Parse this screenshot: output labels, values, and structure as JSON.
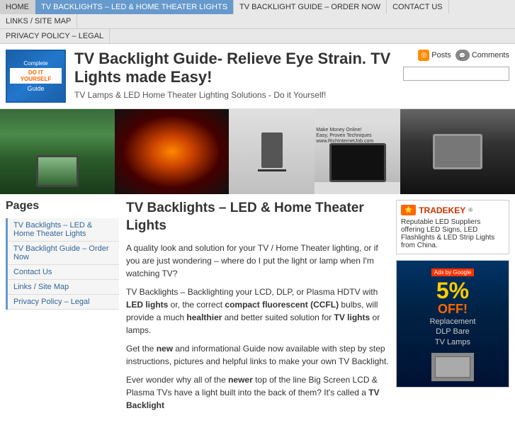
{
  "nav": {
    "items": [
      {
        "label": "HOME",
        "active": false
      },
      {
        "label": "TV BACKLIGHTS – LED & HOME THEATER LIGHTS",
        "active": true
      },
      {
        "label": "TV BACKLIGHT GUIDE – ORDER NOW",
        "active": false
      },
      {
        "label": "CONTACT US",
        "active": false
      },
      {
        "label": "LINKS / SITE MAP",
        "active": false
      }
    ],
    "second_row": [
      {
        "label": "PRIVACY POLICY – LEGAL"
      }
    ]
  },
  "header": {
    "logo": {
      "complete": "Complete",
      "diy": "DO IT YOURSELF",
      "guide": "Guide"
    },
    "title": "TV Backlight Guide- Relieve Eye Strain. TV Lights made Easy!",
    "subtitle": "TV Lamps & LED Home Theater Lighting Solutions - Do it Yourself!",
    "feeds": {
      "posts_label": "Posts",
      "comments_label": "Comments"
    },
    "search_placeholder": ""
  },
  "sidebar": {
    "heading": "Pages",
    "items": [
      {
        "label": "TV Backlights – LED & Home Theater Lights"
      },
      {
        "label": "TV Backlight Guide – Order Now"
      },
      {
        "label": "Contact Us"
      },
      {
        "label": "Links / Site Map"
      },
      {
        "label": "Privacy Policy – Legal"
      }
    ]
  },
  "content": {
    "heading": "TV Backlights – LED & Home Theater Lights",
    "paragraphs": [
      "A quality look and solution for your TV / Home Theater lighting, or if you are just wondering – where do I put the light or lamp when I'm watching TV?",
      " TV Backlights – Backlighting your LCD, DLP, or Plasma HDTV with LED lights or, the correct compact fluorescent (CCFL) bulbs, will provide a much healthier and better suited solution for TV lights or lamps.",
      "Get the new and informational Guide now available with step by step instructions, pictures and helpful links to make your own TV Backlight.",
      "Ever wonder why all of the newer top of the line Big Screen LCD & Plasma TVs have a light built into the back of them? It's called a TV Backlight"
    ]
  },
  "right_sidebar": {
    "tradekey": {
      "logo_text": "TRADEKEY",
      "description": "Reputable LED Suppliers offering LED Signs, LED Flashlights & LED Strip Lights from China."
    },
    "ad": {
      "badge": "Ads by Google",
      "percent": "5%",
      "off": "OFF!",
      "line1": "Replacement",
      "line2": "DLP Bare",
      "line3": "TV Lamps"
    }
  }
}
